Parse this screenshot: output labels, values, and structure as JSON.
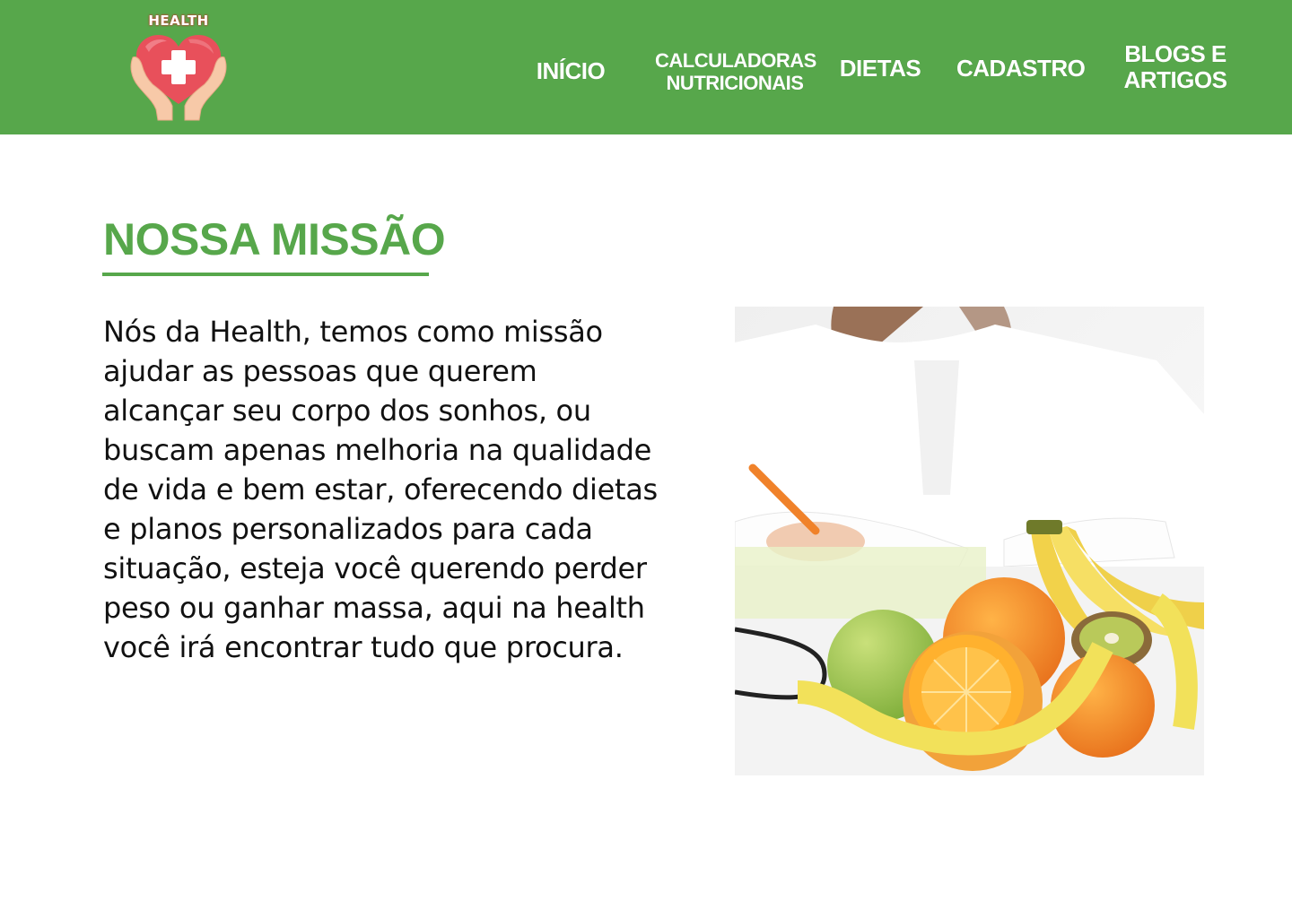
{
  "header": {
    "logo_text": "HEALTH",
    "nav": {
      "inicio": "INÍCIO",
      "calc_line1": "CALCULADORAS",
      "calc_line2": "NUTRICIONAIS",
      "dietas": "DIETAS",
      "cadastro": "CADASTRO",
      "blogs_line1": "BLOGS E",
      "blogs_line2": "ARTIGOS"
    }
  },
  "mission": {
    "title": "NOSSA MISSÃO",
    "text": "Nós da Health, temos como missão ajudar as pessoas que querem alcançar seu corpo dos sonhos, ou buscam apenas melhoria na qualidade de vida e bem estar, oferecendo dietas e planos personalizados para cada situação, esteja você querendo perder peso ou ganhar massa, aqui na health você irá encontrar tudo que procura."
  },
  "colors": {
    "brand_green": "#57a74b",
    "heart_red": "#e8505b"
  },
  "icons": {
    "logo": "heart-hands-cross-icon"
  }
}
